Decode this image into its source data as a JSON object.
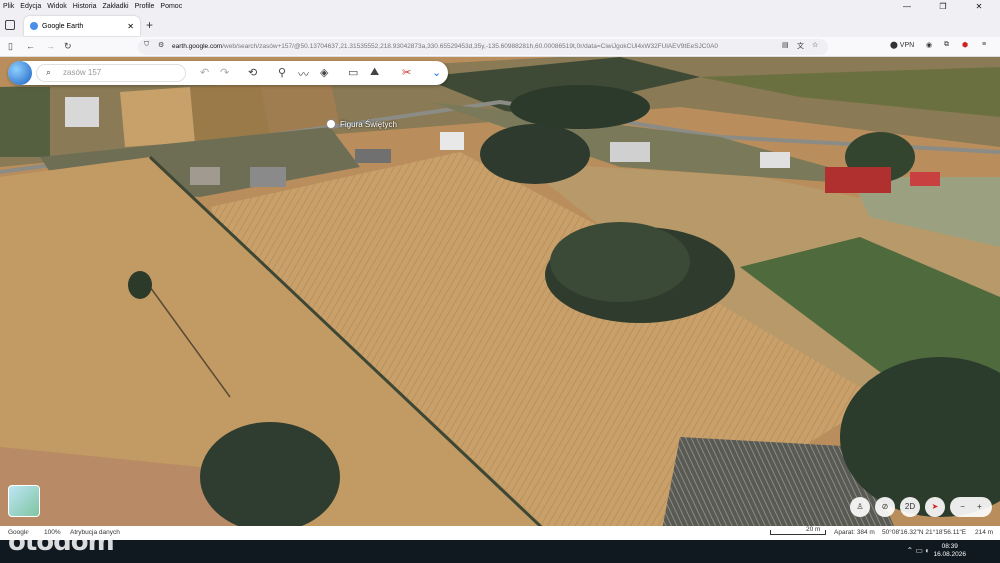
{
  "menu": {
    "items": [
      "Plik",
      "Edycja",
      "Widok",
      "Historia",
      "Zakładki",
      "Profile",
      "Pomoc"
    ]
  },
  "tab": {
    "title": "Google Earth"
  },
  "url": {
    "prefix": "",
    "host": "earth.google.com",
    "path": "/web/search/zasów+157/@50.13704637,21.31535552,218.93042873a,330.65529453d,35y,-135.60988281h,60.00086519t,0r/data=CiwiJgokCUl4xW32FUlAEV9tEeSJC0A0"
  },
  "toolbar": {
    "vpn_label": "VPN"
  },
  "search": {
    "placeholder": "zasów 157"
  },
  "map": {
    "place_label": "Figura Świętych",
    "view_2d": "2D",
    "zoom_out": "−",
    "zoom_in": "+"
  },
  "status": {
    "google": "Google",
    "percent": "100%",
    "attribution": "Atrybucja danych",
    "scale_label": "20 m",
    "camera": "Aparat: 384 m",
    "coords": "50°08'16.32\"N 21°18'56.11\"E",
    "elevation": "214 m"
  },
  "taskbar": {
    "time": "08:39",
    "date": "16.08.2026"
  },
  "watermark": "otodom",
  "colors": {
    "field": "#c9a06a",
    "forest": "#2b3a2a",
    "accent": "#1a73e8"
  }
}
